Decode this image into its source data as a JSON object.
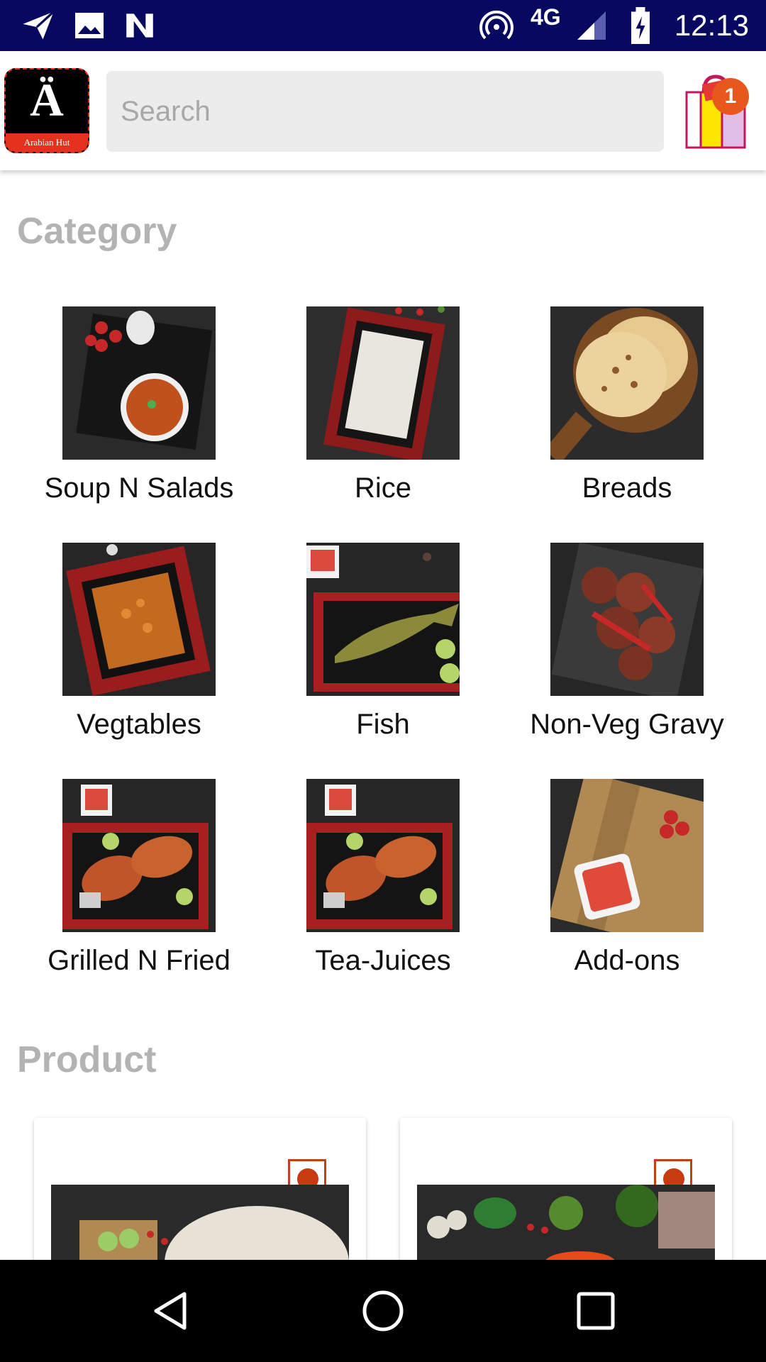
{
  "status_bar": {
    "network": "4G",
    "time": "12:13",
    "icons": [
      "telegram-icon",
      "image-icon",
      "n-icon",
      "hotspot-icon",
      "signal-icon",
      "battery-charging-icon"
    ]
  },
  "app_bar": {
    "logo_letter": "Ä",
    "logo_text": "Arabian Hut",
    "search_placeholder": "Search",
    "cart_count": "1"
  },
  "category": {
    "title": "Category",
    "items": [
      {
        "label": "Soup N Salads",
        "image": "soup-bowl"
      },
      {
        "label": "Rice",
        "image": "rice-plate"
      },
      {
        "label": "Breads",
        "image": "bread"
      },
      {
        "label": "Vegtables",
        "image": "veg-curry"
      },
      {
        "label": "Fish",
        "image": "grilled-fish"
      },
      {
        "label": "Non-Veg Gravy",
        "image": "chicken-gravy"
      },
      {
        "label": "Grilled N Fried",
        "image": "fried-chicken"
      },
      {
        "label": "Tea-Juices",
        "image": "fried-chicken"
      },
      {
        "label": "Add-ons",
        "image": "sauce-board"
      }
    ]
  },
  "product": {
    "title": "Product"
  },
  "colors": {
    "status_bar": "#070860",
    "accent": "#e8571b",
    "heading": "#b3b3b3"
  }
}
